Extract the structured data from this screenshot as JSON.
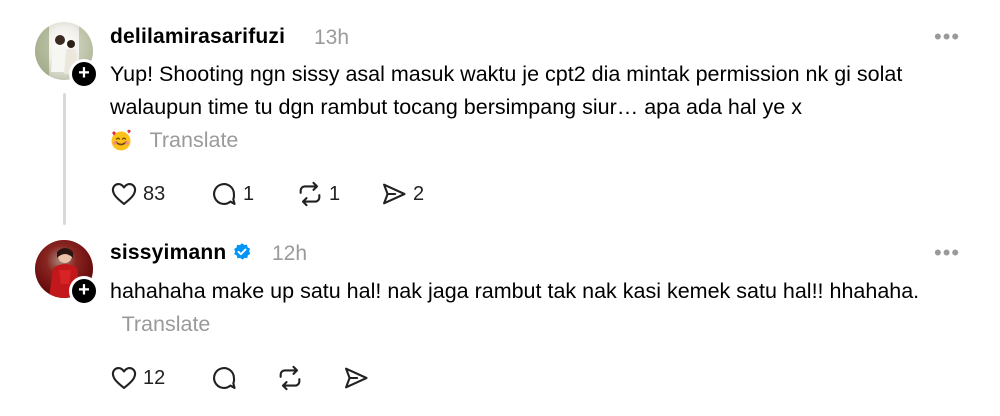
{
  "posts": [
    {
      "username": "delilamirasarifuzi",
      "time": "13h",
      "more": "•••",
      "text": "Yup! Shooting ngn sissy asal masuk waktu je cpt2 dia mintak permission nk gi solat walaupun time tu dgn rambut tocang bersimpang siur… apa ada hal ye x",
      "translate_label": "Translate",
      "actions": {
        "likes": "83",
        "replies": "1",
        "reposts": "1",
        "shares": "2"
      }
    },
    {
      "username": "sissyimann",
      "verified": true,
      "time": "12h",
      "more": "•••",
      "text": "hahahaha make up satu hal! nak jaga rambut tak nak kasi kemek satu hal!! hhahaha.",
      "translate_label": "Translate",
      "actions": {
        "likes": "12"
      }
    }
  ],
  "icons": [
    "heart-icon",
    "reply-icon",
    "repost-icon",
    "share-icon",
    "verified-icon",
    "plus-icon",
    "smiling-face-with-hearts-icon"
  ],
  "colors": {
    "muted": "#9a9a9a",
    "verified": "#0095f6",
    "line": "#d9d9d9"
  }
}
